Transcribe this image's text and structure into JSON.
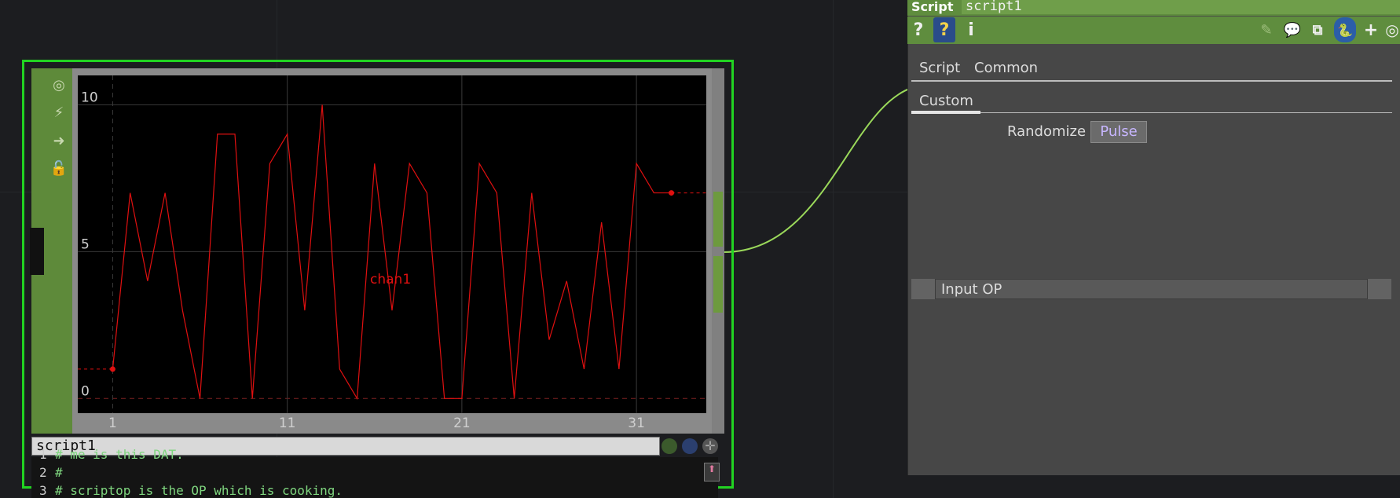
{
  "network": {
    "node": {
      "viewer_channel_label": "chan1",
      "dat": {
        "title": "script1",
        "lines": [
          {
            "num": "1",
            "text": "# me is this DAT."
          },
          {
            "num": "2",
            "text": "#"
          },
          {
            "num": "3",
            "text": "# scriptop is the OP which is cooking."
          }
        ]
      }
    }
  },
  "chart_data": {
    "type": "line",
    "series": [
      {
        "name": "chan1",
        "color": "#e01010",
        "x": [
          1,
          2,
          3,
          4,
          5,
          6,
          7,
          8,
          9,
          10,
          11,
          12,
          13,
          14,
          15,
          16,
          17,
          18,
          19,
          20,
          21,
          22,
          23,
          24,
          25,
          26,
          27,
          28,
          29,
          30,
          31,
          32,
          33
        ],
        "values": [
          1,
          7,
          4,
          7,
          3,
          0,
          9,
          9,
          0,
          8,
          9,
          3,
          10,
          1,
          0,
          8,
          3,
          8,
          7,
          0,
          0,
          8,
          7,
          0,
          7,
          2,
          4,
          1,
          6,
          1,
          8,
          7,
          7
        ]
      }
    ],
    "xticks": [
      "1",
      "11",
      "21",
      "31"
    ],
    "yticks": [
      "0",
      "5",
      "10"
    ],
    "xlim": [
      -1,
      35
    ],
    "ylim": [
      -0.5,
      11
    ]
  },
  "panel": {
    "op_type": "Script",
    "op_name": "script1",
    "toolbar_icons": [
      "help-icon",
      "python-help-icon",
      "info-icon",
      "pencil-icon",
      "comment-icon",
      "clone-icon",
      "python-icon",
      "add-icon",
      "target-icon"
    ],
    "toolbar_glyphs": {
      "help": "?",
      "pyhelp": "?",
      "info": "i",
      "add": "+"
    },
    "tabs": [
      "Script",
      "Common"
    ],
    "active_page": "Custom",
    "param": {
      "label": "Randomize",
      "button": "Pulse"
    },
    "input_op_label": "Input OP"
  },
  "colors": {
    "node_border": "#22d322",
    "wire": "#9ad85a",
    "accent_green": "#5f8d3e",
    "pulse_text": "#c7b6ff"
  }
}
